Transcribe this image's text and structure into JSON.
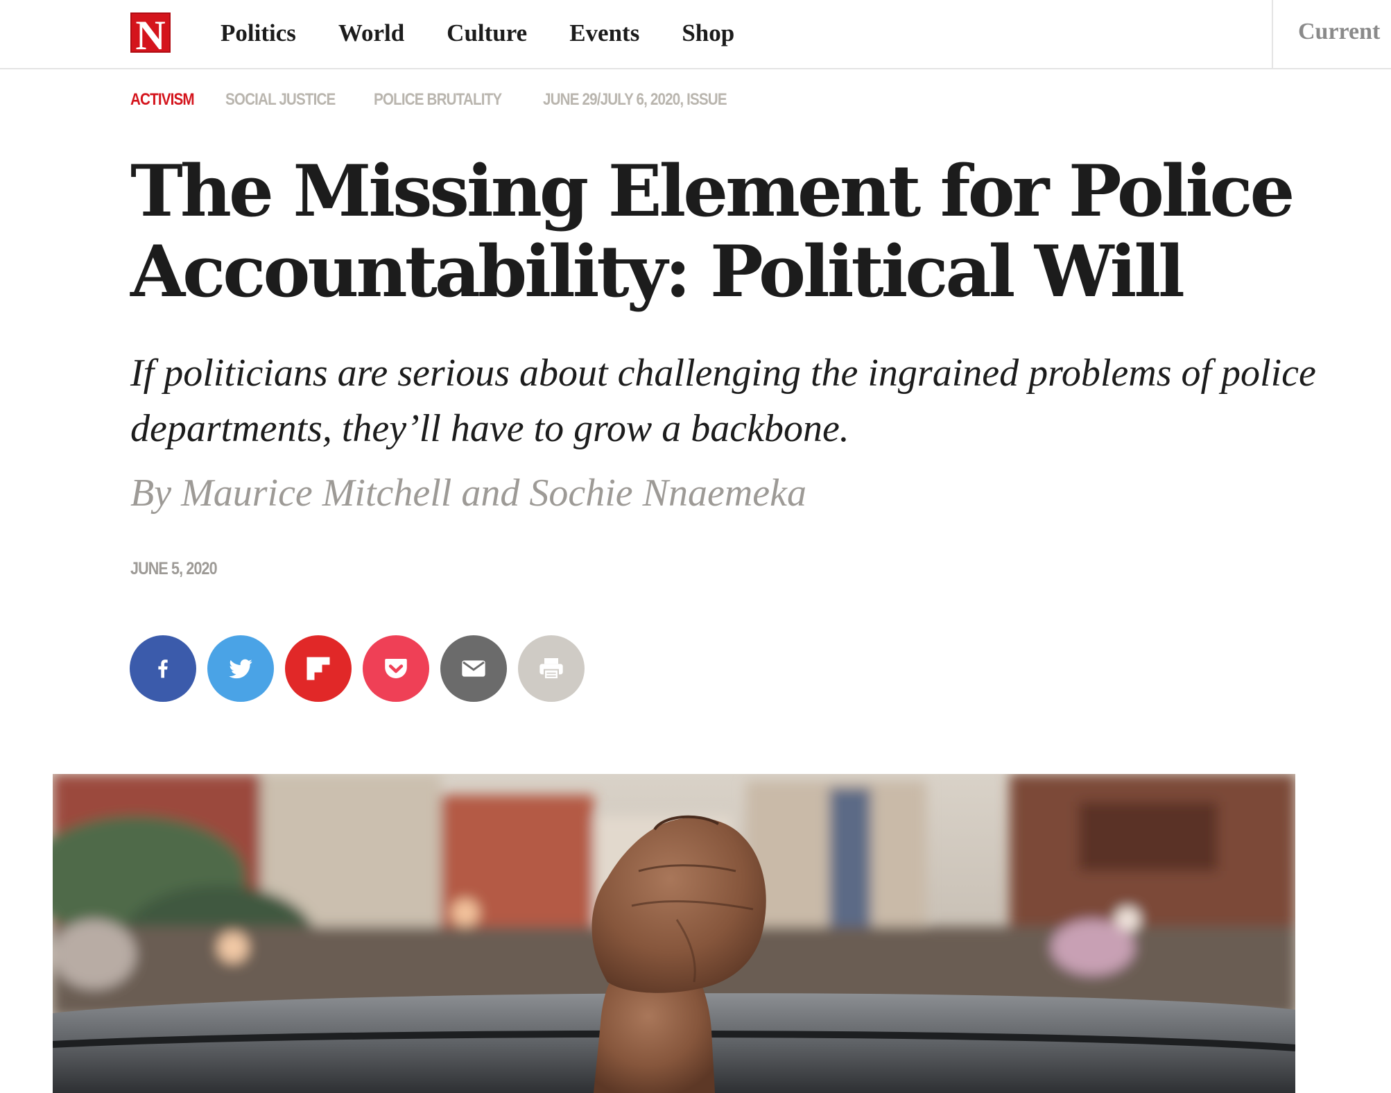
{
  "header": {
    "logo_letter": "N",
    "nav": [
      "Politics",
      "World",
      "Culture",
      "Events",
      "Shop"
    ],
    "current_label": "Current"
  },
  "article": {
    "tags": [
      "Activism",
      "Social Justice",
      "Police Brutality",
      "June 29/July 6, 2020, Issue"
    ],
    "headline_line1": "The Missing Element for Police",
    "headline_line2": "Accountability: Political Will",
    "dek": "If politicians are serious about challenging the ingrained problems of police departments, they’ll have to grow a backbone.",
    "byline": "By Maurice Mitchell and Sochie Nnaemeka",
    "date": "JUNE 5, 2020"
  },
  "share": [
    {
      "name": "facebook",
      "icon": "facebook-icon"
    },
    {
      "name": "twitter",
      "icon": "twitter-icon"
    },
    {
      "name": "flipboard",
      "icon": "flipboard-icon"
    },
    {
      "name": "pocket",
      "icon": "pocket-icon"
    },
    {
      "name": "email",
      "icon": "envelope-icon"
    },
    {
      "name": "print",
      "icon": "printer-icon"
    }
  ],
  "colors": {
    "brand_red": "#d4141c",
    "tag_gray": "#b9b5ae",
    "facebook": "#3b5bab",
    "twitter": "#4aa3e6",
    "flipboard": "#e12828",
    "pocket": "#ef4056",
    "email": "#6b6b6b",
    "print": "#cfcbc5"
  },
  "hero_image": {
    "subject": "raised-fist-photo"
  }
}
